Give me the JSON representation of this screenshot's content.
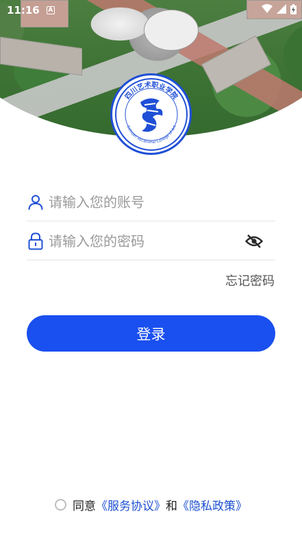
{
  "status_bar": {
    "time": "11:16",
    "notification_glyph": "A",
    "icons": [
      "wifi-icon",
      "cellular-signal-icon",
      "battery-charging-icon"
    ]
  },
  "hero": {
    "image": "campus-aerial-photo"
  },
  "logo": {
    "image": "sichuan-vocational-college-of-art-seal",
    "text_cn": "四川艺术职业学院",
    "text_en": "Sichuan Vocational College of Art",
    "color": "#1f4fd6"
  },
  "login_form": {
    "account_placeholder": "请输入您的账号",
    "password_placeholder": "请输入您的密码",
    "account_icon": "user-icon",
    "password_icon": "lock-icon",
    "visibility_icon": "eye-off-icon",
    "forgot_label": "忘记密码"
  },
  "login_button": {
    "label": "登录",
    "color": "#1a4ff0"
  },
  "agreement": {
    "prefix": "同意",
    "service_link": "《服务协议》",
    "joiner": "和",
    "privacy_link": "《隐私政策》",
    "link_color": "#1c4fd0"
  }
}
